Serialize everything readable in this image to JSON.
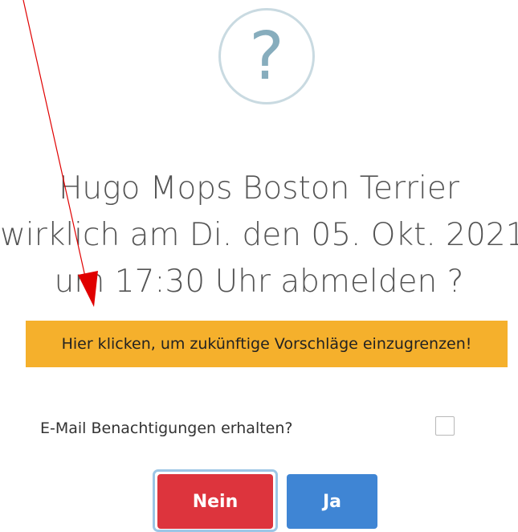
{
  "dialog": {
    "icon": "question-mark-icon",
    "icon_glyph": "?",
    "message_lines": [
      "Hugo Mops Boston Terrier",
      "wirklich am Di. den 05. Okt. 2021",
      "um 17:30 Uhr abmelden ?"
    ],
    "filter_banner_label": "Hier klicken, um zukünftige Vorschläge einzugrenzen!",
    "email_label": "E-Mail Benachtigungen erhalten?",
    "email_checked": false,
    "buttons": {
      "no_label": "Nein",
      "yes_label": "Ja"
    }
  },
  "colors": {
    "banner": "#f5b02c",
    "no_button": "#dd343d",
    "yes_button": "#3f85d4",
    "annotation_arrow": "#e00000"
  }
}
